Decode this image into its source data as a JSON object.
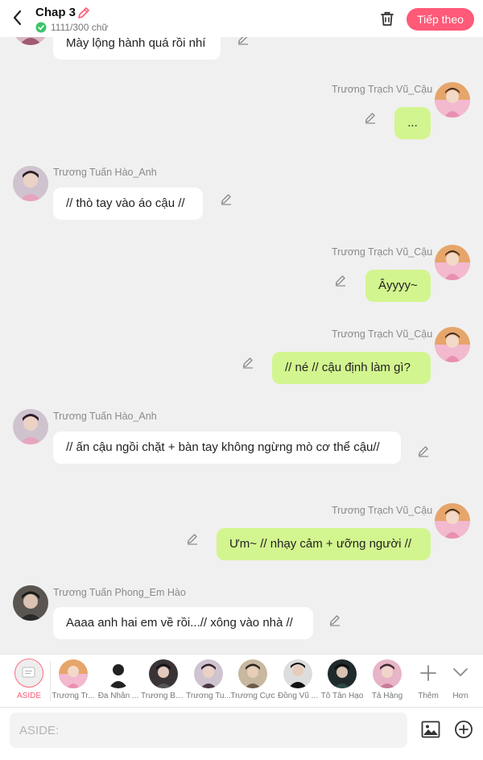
{
  "header": {
    "title": "Chap 3",
    "char_count": "1111/300 chữ",
    "next_label": "Tiếp theo",
    "accent_color": "#ff5a78"
  },
  "messages": [
    {
      "side": "left",
      "name": "",
      "text": "Mày lộng hành quá rồi nhí"
    },
    {
      "side": "right",
      "name": "Trương Trạch Vũ_Cậu",
      "text": "..."
    },
    {
      "side": "left",
      "name": "Trương Tuấn Hào_Anh",
      "text": "// thò tay vào áo cậu //"
    },
    {
      "side": "right",
      "name": "Trương Trạch Vũ_Cậu",
      "text": "Âyyyy~"
    },
    {
      "side": "right",
      "name": "Trương Trạch Vũ_Cậu",
      "text": "// né // cậu định làm gì?"
    },
    {
      "side": "left",
      "name": "Trương Tuấn Hào_Anh",
      "text": "// ấn cậu ngồi chặt + bàn tay không ngừng mò cơ thể cậu//"
    },
    {
      "side": "right",
      "name": "Trương Trạch Vũ_Cậu",
      "text": "Ưm~ // nhạy cảm + ưỡng người //"
    },
    {
      "side": "left",
      "name": "Trương Tuấn Phong_Em Hào",
      "text": "Aaaa anh hai em về rồi...// xông vào nhà //"
    }
  ],
  "characters": {
    "aside": "ASIDE",
    "items": [
      {
        "label": "Trương Tr..."
      },
      {
        "label": "Đa Nhân ..."
      },
      {
        "label": "Trương Bả..."
      },
      {
        "label": "Trương Tu..."
      },
      {
        "label": "Trương Cực"
      },
      {
        "label": "Đồng Vũ ..."
      },
      {
        "label": "Tô Tân Hạo"
      },
      {
        "label": "Tả Hàng"
      }
    ],
    "more_label": "Thêm",
    "collapse_label": "Hơn"
  },
  "input": {
    "placeholder": "ASIDE:"
  },
  "colors": {
    "bubble_right": "#d3f58f",
    "bubble_left": "#ffffff",
    "background": "#f0f0f0"
  },
  "icons": [
    "back-arrow-icon",
    "pencil-icon",
    "check-circle-icon",
    "trash-icon",
    "image-icon",
    "plus-circle-icon",
    "plus-icon",
    "chevron-down-icon"
  ]
}
